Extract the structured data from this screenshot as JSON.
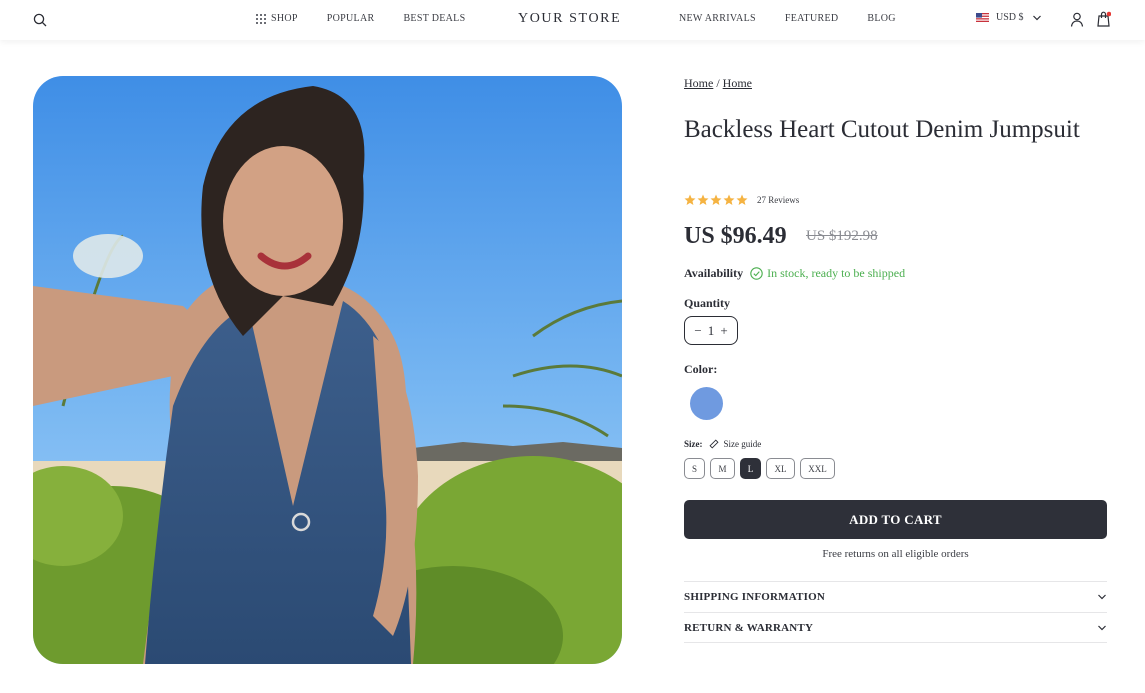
{
  "header": {
    "brand": "YOUR STORE",
    "nav_left": [
      {
        "label": "SHOP",
        "icon": "grid-icon"
      },
      {
        "label": "POPULAR"
      },
      {
        "label": "BEST DEALS"
      }
    ],
    "nav_right": [
      {
        "label": "NEW ARRIVALS"
      },
      {
        "label": "FEATURED"
      },
      {
        "label": "BLOG"
      }
    ],
    "currency": "USD $",
    "icons": [
      "search-icon",
      "us-flag-icon",
      "chevron-down-icon",
      "account-icon",
      "cart-bag-icon"
    ],
    "cart_dot_color": "#e53935"
  },
  "breadcrumb": [
    "Home",
    "Home"
  ],
  "breadcrumb_separator": "/",
  "product": {
    "title": "Backless Heart Cutout Denim Jumpsuit",
    "rating": 5,
    "reviews": "27 Reviews",
    "price": "US $96.49",
    "compare_price": "US $192.98",
    "availability_label": "Availability",
    "availability_text": "In stock, ready to be shipped",
    "quantity_label": "Quantity",
    "quantity_value": "1",
    "color_label": "Color:",
    "color_value": "#6f9ae0",
    "size_label": "Size:",
    "size_guide": "Size guide",
    "sizes": [
      "S",
      "M",
      "L",
      "XL",
      "XXL"
    ],
    "selected_size": "L",
    "add_to_cart": "ADD TO CART",
    "returns_note": "Free returns on all eligible orders",
    "accordions": [
      "SHIPPING INFORMATION",
      "RETURN & WARRANTY"
    ]
  },
  "colors": {
    "primary": "#2e3039",
    "in_stock": "#4caf50",
    "star": "#f5b342",
    "strike": "#8a8c92"
  }
}
